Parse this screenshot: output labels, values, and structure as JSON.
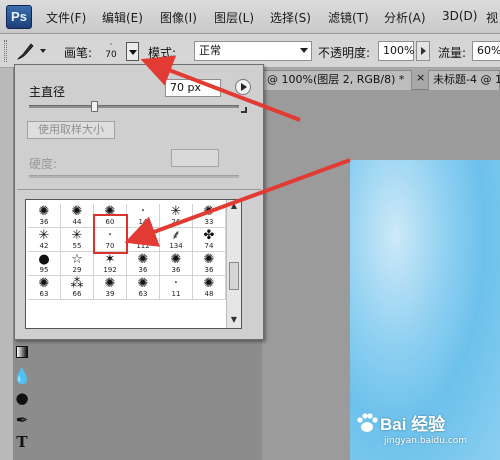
{
  "app": {
    "logo_text": "Ps"
  },
  "menu": [
    "文件(F)",
    "编辑(E)",
    "图像(I)",
    "图层(L)",
    "选择(S)",
    "滤镜(T)",
    "分析(A)",
    "3D(D)",
    "视"
  ],
  "options_bar": {
    "brush_label": "画笔:",
    "brush_size": "70",
    "mode_label": "模式:",
    "mode_value": "正常",
    "opacity_label": "不透明度:",
    "opacity_value": "100%",
    "flow_label": "流量:",
    "flow_value": "60%"
  },
  "doc_tabs": [
    "@ 100%(图层 2, RGB/8) *",
    "×",
    "未标题-4 @ 1"
  ],
  "brush_panel": {
    "master_diameter_label": "主直径",
    "master_diameter_value": "70 px",
    "master_diameter_slider": 0.31,
    "sample_size_button": "使用取样大小",
    "hardness_label": "硬度:",
    "brushes": [
      {
        "size": "36",
        "glyph": "✺"
      },
      {
        "size": "44",
        "glyph": "✺"
      },
      {
        "size": "60",
        "glyph": "✺"
      },
      {
        "size": "14",
        "glyph": "·"
      },
      {
        "size": "26",
        "glyph": "✳"
      },
      {
        "size": "33",
        "glyph": "✺"
      },
      {
        "size": "42",
        "glyph": "✳"
      },
      {
        "size": "55",
        "glyph": "✳"
      },
      {
        "size": "70",
        "glyph": "·"
      },
      {
        "size": "112",
        "glyph": "✦"
      },
      {
        "size": "134",
        "glyph": "⸙"
      },
      {
        "size": "74",
        "glyph": "✤"
      },
      {
        "size": "95",
        "glyph": "●"
      },
      {
        "size": "29",
        "glyph": "☆"
      },
      {
        "size": "192",
        "glyph": "✶"
      },
      {
        "size": "36",
        "glyph": "✺"
      },
      {
        "size": "36",
        "glyph": "✺"
      },
      {
        "size": "36",
        "glyph": "✺"
      },
      {
        "size": "63",
        "glyph": "✺"
      },
      {
        "size": "66",
        "glyph": "⁂"
      },
      {
        "size": "39",
        "glyph": "✺"
      },
      {
        "size": "63",
        "glyph": "✺"
      },
      {
        "size": "11",
        "glyph": "·"
      },
      {
        "size": "48",
        "glyph": "✺"
      }
    ],
    "selected_index": 8
  },
  "watermark": {
    "brand": "Bai 经验",
    "url": "jingyan.baidu.com"
  },
  "colors": {
    "accent": "#d9322c",
    "canvas": "#7fc8ee"
  }
}
